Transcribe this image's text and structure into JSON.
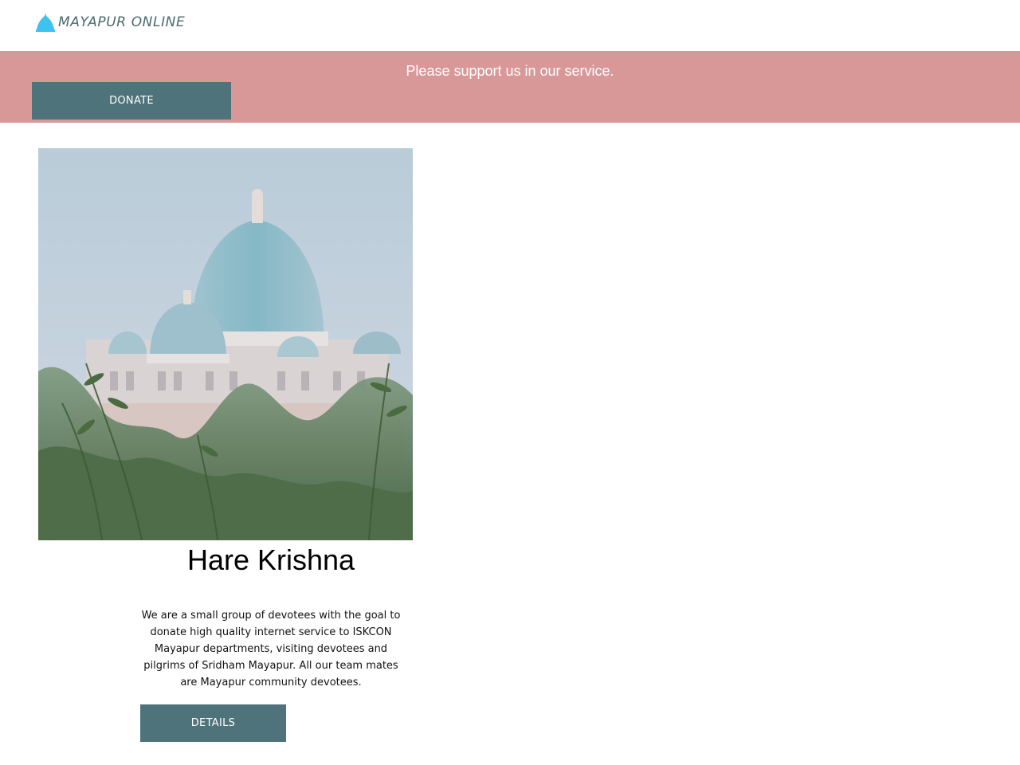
{
  "header": {
    "logo_text": "MAYAPUR ONLINE",
    "logo_icon": "temple-dome-icon"
  },
  "banner": {
    "message": "Please support us in our service.",
    "donate_label": "DONATE"
  },
  "main": {
    "hero_image": "temple-domes-photo",
    "heading": "Hare Krishna",
    "description": "We are a small group of devotees with the goal to donate high quality internet service to ISKCON Mayapur departments, visiting devotees and pilgrims of Sridham Mayapur. All our team mates are Mayapur community devotees.",
    "details_label": "DETAILS"
  },
  "colors": {
    "banner_bg": "#d99898",
    "button_bg": "#4f737b",
    "logo_text": "#4c6a6e",
    "logo_icon": "#3ec3f0"
  }
}
